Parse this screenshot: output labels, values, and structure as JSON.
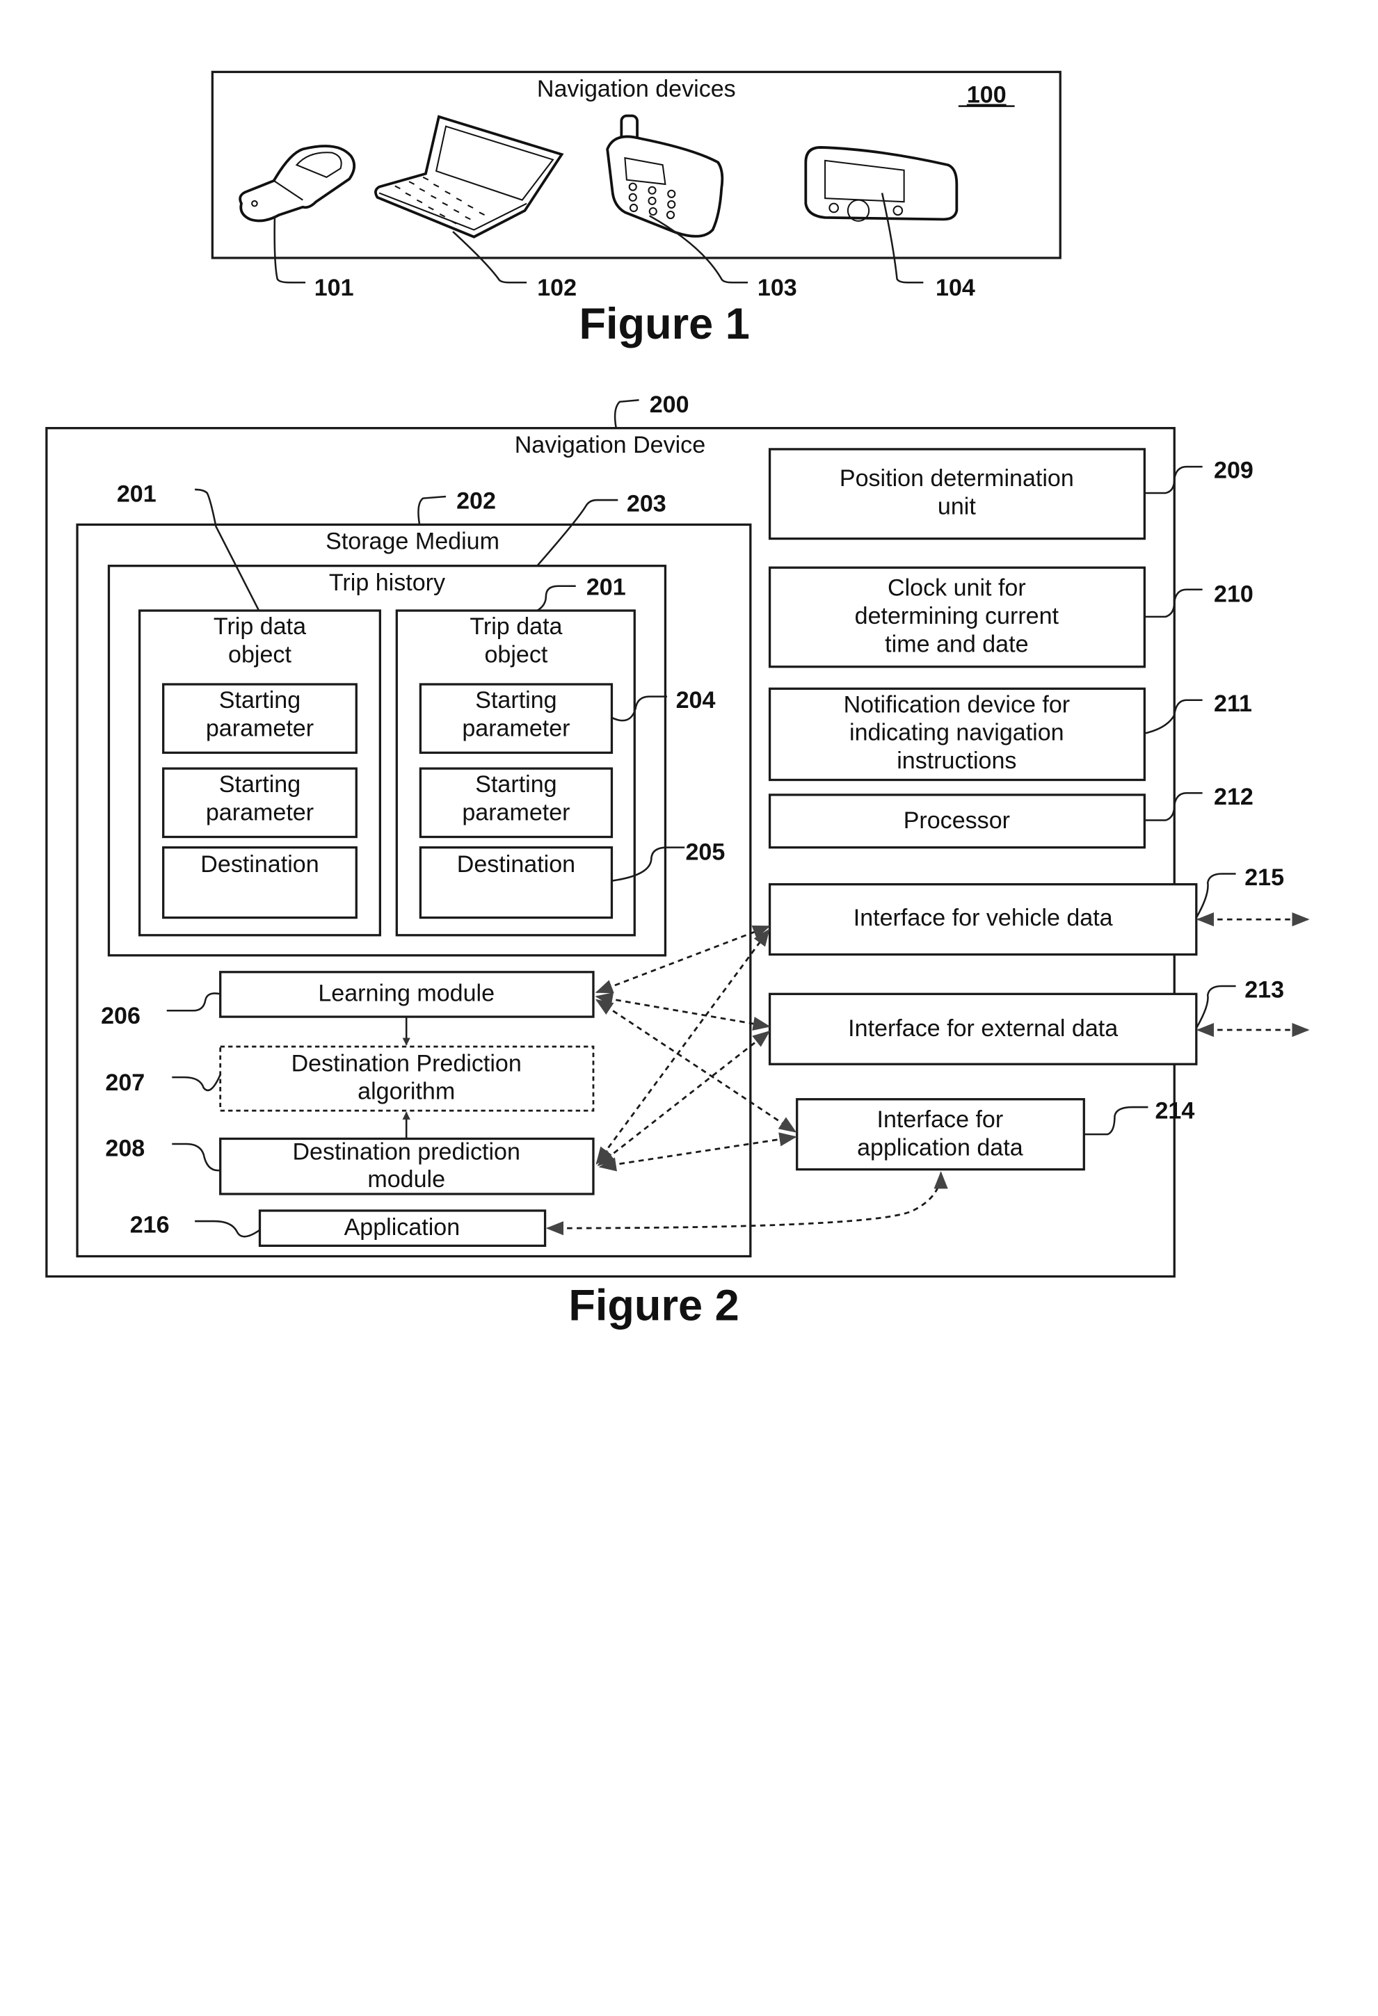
{
  "figure1": {
    "title": "Navigation devices",
    "ref": "100",
    "caption": "Figure 1",
    "devices": [
      {
        "icon": "flip-phone-icon",
        "ref": "101"
      },
      {
        "icon": "laptop-icon",
        "ref": "102"
      },
      {
        "icon": "mobile-phone-icon",
        "ref": "103"
      },
      {
        "icon": "gps-navigator-icon",
        "ref": "104"
      }
    ]
  },
  "figure2": {
    "caption": "Figure 2",
    "device": {
      "label": "Navigation Device",
      "ref": "200"
    },
    "storage": {
      "label": "Storage Medium",
      "ref": "202"
    },
    "trip_history": {
      "label": "Trip history",
      "ref": "203"
    },
    "trip_objects": [
      {
        "title_line1": "Trip data",
        "title_line2": "object",
        "ref": "201",
        "params": [
          {
            "line1": "Starting",
            "line2": "parameter"
          },
          {
            "line1": "Starting",
            "line2": "parameter"
          }
        ],
        "destination": "Destination"
      },
      {
        "title_line1": "Trip data",
        "title_line2": "object",
        "ref": "201",
        "params": [
          {
            "line1": "Starting",
            "line2": "parameter",
            "ref": "204"
          },
          {
            "line1": "Starting",
            "line2": "parameter"
          }
        ],
        "destination": "Destination",
        "destination_ref": "205"
      }
    ],
    "modules": {
      "learning": {
        "label": "Learning module",
        "ref": "206"
      },
      "algorithm": {
        "line1": "Destination Prediction",
        "line2": "algorithm",
        "ref": "207"
      },
      "prediction": {
        "line1": "Destination prediction",
        "line2": "module",
        "ref": "208"
      },
      "application": {
        "label": "Application",
        "ref": "216"
      }
    },
    "units": [
      {
        "lines": [
          "Position determination",
          "unit"
        ],
        "ref": "209"
      },
      {
        "lines": [
          "Clock unit for",
          "determining current",
          "time and date"
        ],
        "ref": "210"
      },
      {
        "lines": [
          "Notification device for",
          "indicating navigation",
          "instructions"
        ],
        "ref": "211"
      },
      {
        "lines": [
          "Processor"
        ],
        "ref": "212"
      }
    ],
    "interfaces": {
      "vehicle": {
        "label": "Interface for vehicle data",
        "ref": "215"
      },
      "external": {
        "label": "Interface for external data",
        "ref": "213"
      },
      "application": {
        "line1": "Interface for",
        "line2": "application data",
        "ref": "214"
      }
    }
  }
}
